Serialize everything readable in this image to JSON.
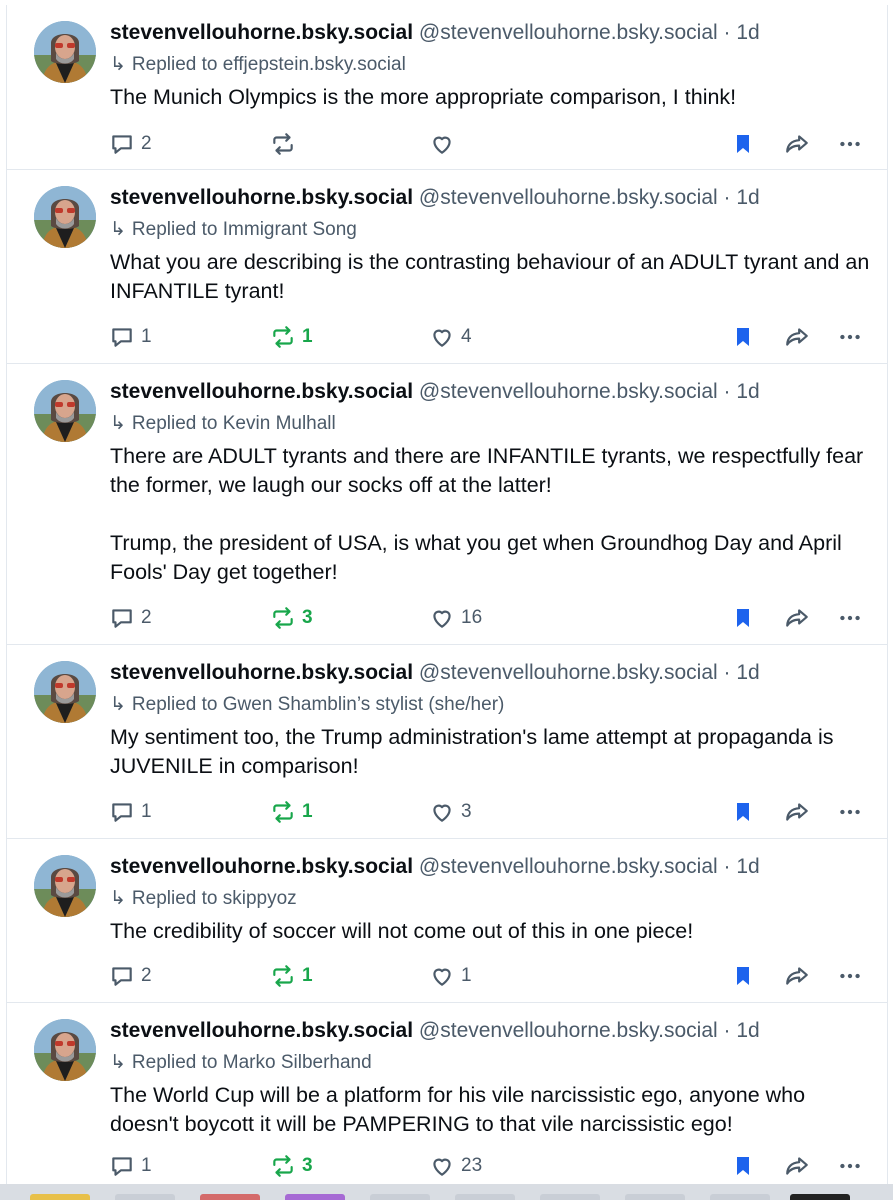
{
  "colors": {
    "accent": "#1d63ed",
    "repost_active": "#18a64b",
    "muted": "#4b5a69",
    "divider": "#e3e8ee"
  },
  "icons": {
    "reply": "speech-bubble-icon",
    "repost": "repost-arrows-icon",
    "like": "heart-icon",
    "bookmark": "bookmark-filled-icon",
    "share": "share-arrow-icon",
    "more": "ellipsis-icon"
  },
  "posts": [
    {
      "display_name": "stevenvellouhorne.bsky.social",
      "handle": "@stevenvellouhorne.bsky.social",
      "separator": "·",
      "time": "1d",
      "reply_to": "Replied to effjepstein.bsky.social",
      "text": "The Munich Olympics is the more appropriate comparison, I think!",
      "replies": "2",
      "reposts": "",
      "likes": "",
      "reposted": false
    },
    {
      "display_name": "stevenvellouhorne.bsky.social",
      "handle": "@stevenvellouhorne.bsky.social",
      "separator": "·",
      "time": "1d",
      "reply_to": "Replied to Immigrant Song",
      "text": "What you are describing is the contrasting behaviour of an ADULT tyrant and an INFANTILE tyrant!",
      "replies": "1",
      "reposts": "1",
      "likes": "4",
      "reposted": true
    },
    {
      "display_name": "stevenvellouhorne.bsky.social",
      "handle": "@stevenvellouhorne.bsky.social",
      "separator": "·",
      "time": "1d",
      "reply_to": "Replied to Kevin Mulhall",
      "text": "There are ADULT tyrants and there are INFANTILE tyrants, we respectfully fear the former, we laugh our socks off at the latter!\n\nTrump, the president of USA, is what you get when Groundhog Day and April Fools' Day get together!",
      "replies": "2",
      "reposts": "3",
      "likes": "16",
      "reposted": true
    },
    {
      "display_name": "stevenvellouhorne.bsky.social",
      "handle": "@stevenvellouhorne.bsky.social",
      "separator": "·",
      "time": "1d",
      "reply_to": "Replied to Gwen Shamblin’s stylist (she/her)",
      "text": "My sentiment too, the Trump administration's lame attempt at propaganda is JUVENILE in comparison!",
      "replies": "1",
      "reposts": "1",
      "likes": "3",
      "reposted": true
    },
    {
      "display_name": "stevenvellouhorne.bsky.social",
      "handle": "@stevenvellouhorne.bsky.social",
      "separator": "·",
      "time": "1d",
      "reply_to": "Replied to skippyoz",
      "text": "The credibility of soccer will not come out of this in one piece!",
      "replies": "2",
      "reposts": "1",
      "likes": "1",
      "reposted": true
    },
    {
      "display_name": "stevenvellouhorne.bsky.social",
      "handle": "@stevenvellouhorne.bsky.social",
      "separator": "·",
      "time": "1d",
      "reply_to": "Replied to Marko Silberhand",
      "text": "The World Cup will be a platform for his vile narcissistic ego, anyone who doesn't boycott it will be PAMPERING to that vile narcissistic ego!",
      "replies": "1",
      "reposts": "3",
      "likes": "23",
      "reposted": true
    }
  ]
}
